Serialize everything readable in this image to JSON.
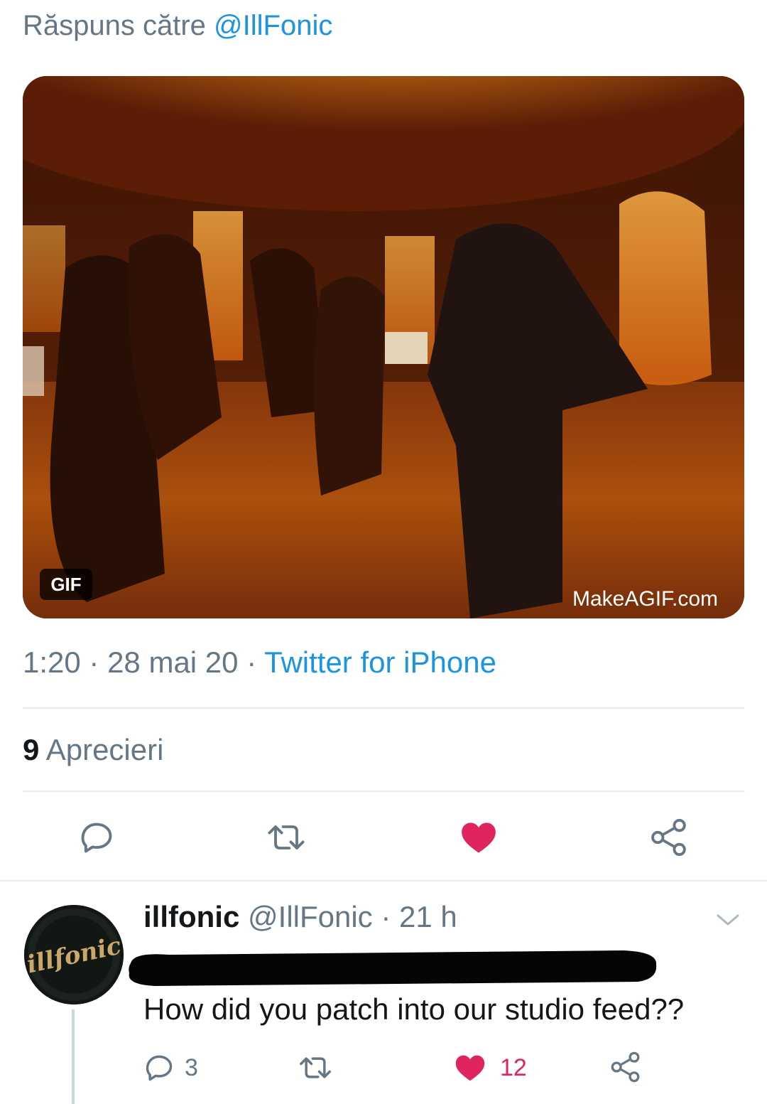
{
  "reply_header": {
    "prefix": "Răspuns către",
    "handle": "@IllFonic"
  },
  "media": {
    "badge": "GIF",
    "watermark": "MakeAGIF.com"
  },
  "tweet_meta": {
    "time": "1:20",
    "sep1": " · ",
    "date": "28 mai 20",
    "sep2": " · ",
    "source": "Twitter for iPhone"
  },
  "stats": {
    "likes_count": "9",
    "likes_label": "Aprecieri"
  },
  "actions": [
    {
      "icon": "reply-icon"
    },
    {
      "icon": "retweet-icon"
    },
    {
      "icon": "heart-filled-icon",
      "color": "#e0245e"
    },
    {
      "icon": "share-icon"
    }
  ],
  "reply": {
    "name": "illfonic",
    "handle": "@IllFonic",
    "sep": " · ",
    "age": "21 h",
    "avatar_text": "illfonic",
    "text": "How did you patch into our studio feed??",
    "reply_count": "3",
    "retweet_count": "",
    "like_count": "12"
  },
  "colors": {
    "link": "#1b95e0",
    "muted": "#657786",
    "like": "#e0245e",
    "divider": "#e6ecf0"
  }
}
